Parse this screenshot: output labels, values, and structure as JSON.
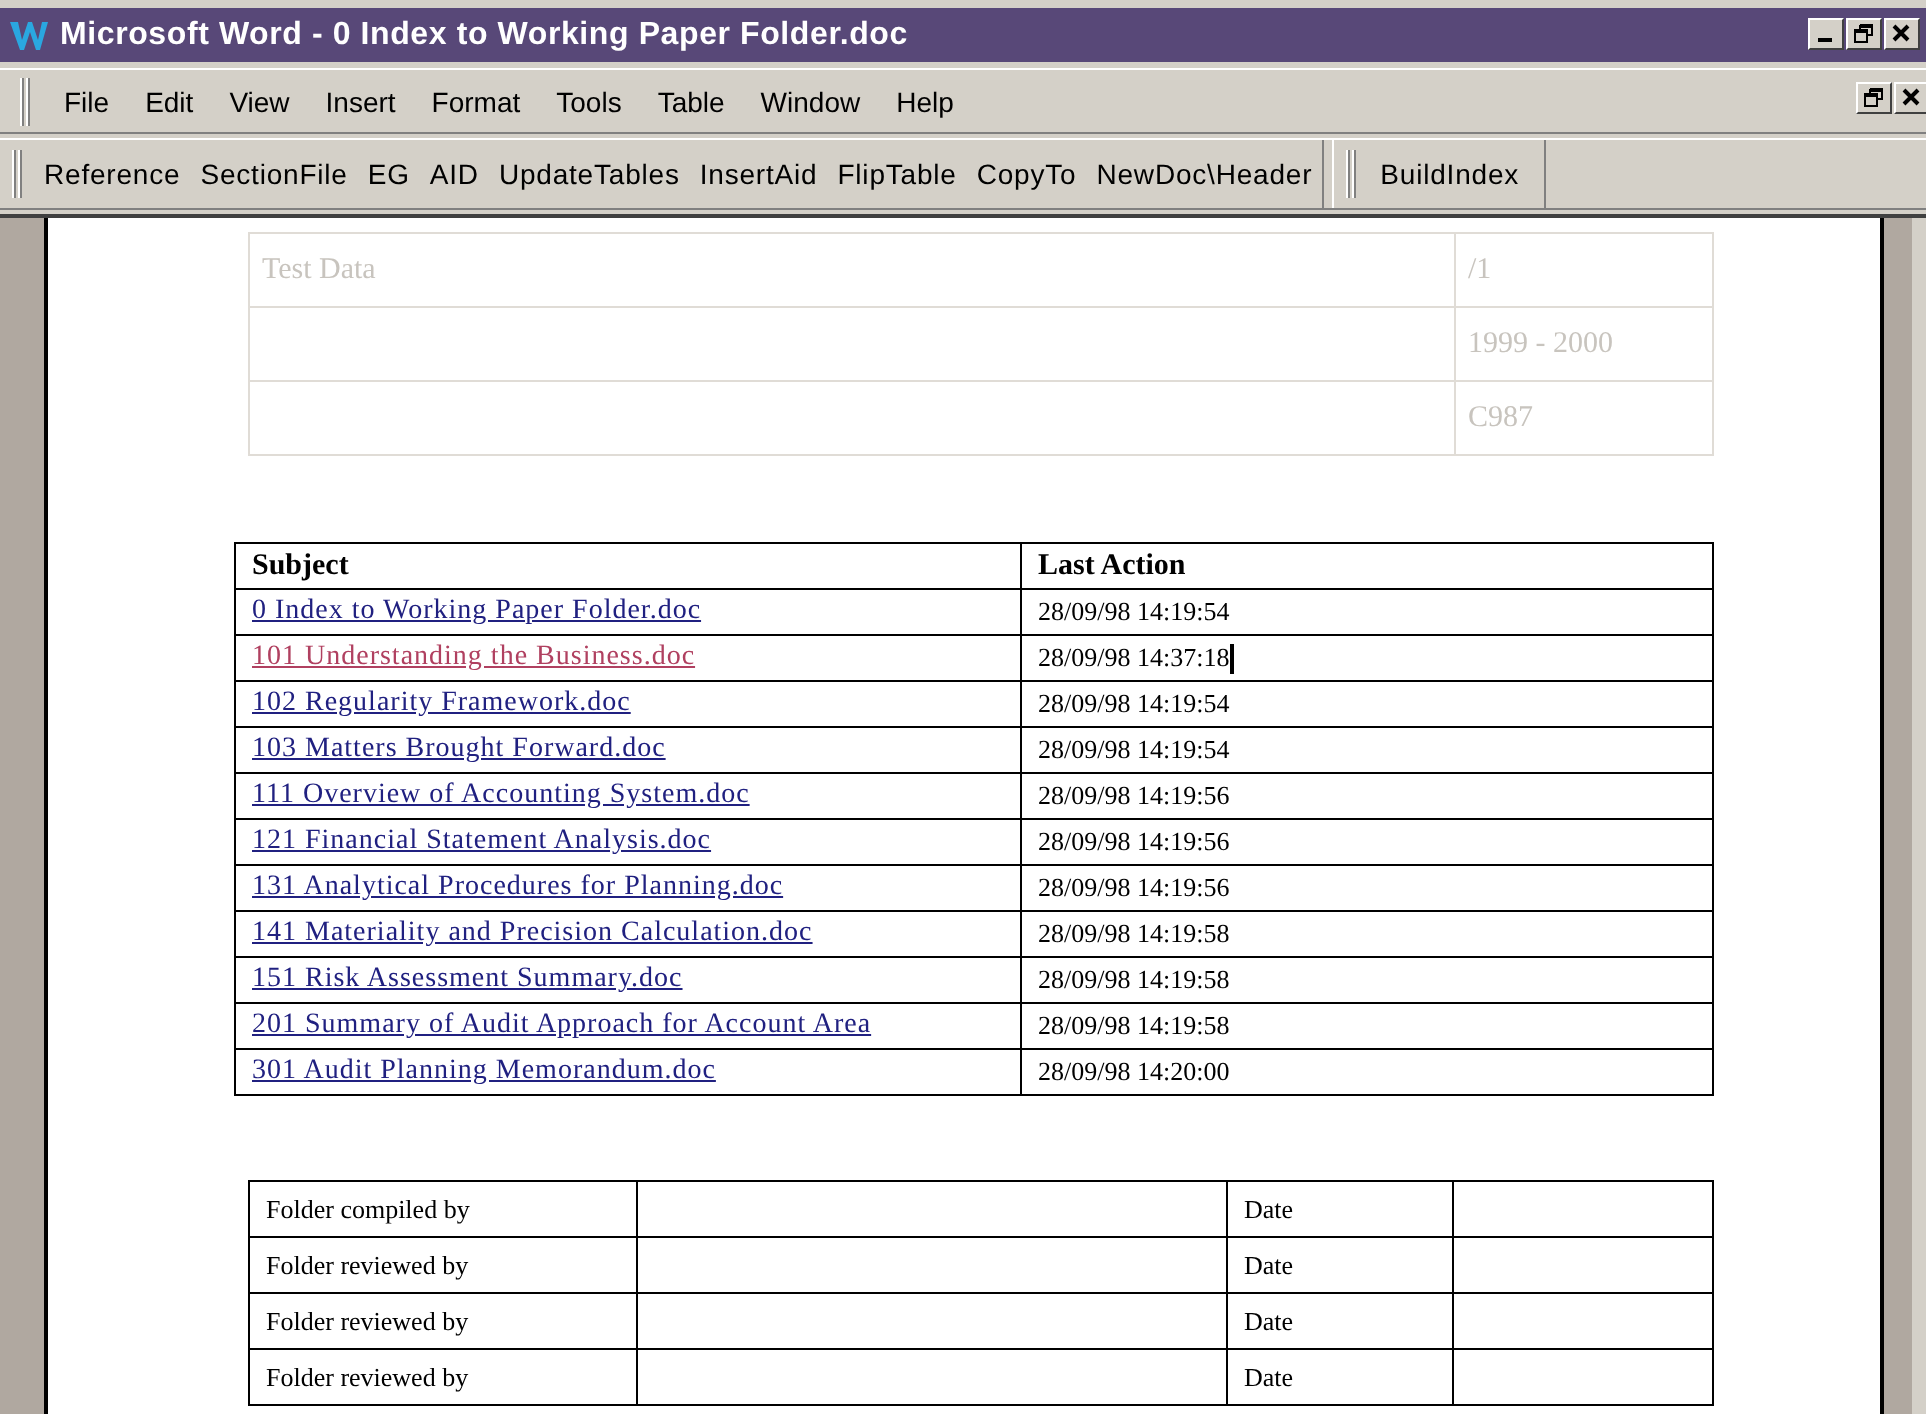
{
  "window": {
    "title": "Microsoft Word - 0 Index to Working Paper Folder.doc"
  },
  "menu_bar": [
    "File",
    "Edit",
    "View",
    "Insert",
    "Format",
    "Tools",
    "Table",
    "Window",
    "Help"
  ],
  "toolbars": [
    {
      "buttons": [
        "Reference",
        "SectionFile",
        "EG",
        "AID",
        "UpdateTables",
        "InsertAid",
        "FlipTable",
        "CopyTo",
        "NewDoc\\Header"
      ]
    },
    {
      "buttons": [
        "BuildIndex"
      ]
    }
  ],
  "document": {
    "header_table": {
      "rows": [
        [
          "Test Data",
          "/1"
        ],
        [
          "",
          "1999 - 2000"
        ],
        [
          "",
          "C987"
        ]
      ]
    },
    "index_table": {
      "columns": [
        "Subject",
        "Last Action"
      ],
      "rows": [
        {
          "subject": "0 Index to Working Paper Folder.doc",
          "last_action": "28/09/98 14:19:54",
          "visited": false
        },
        {
          "subject": "101 Understanding the Business.doc",
          "last_action": "28/09/98 14:37:18",
          "visited": true
        },
        {
          "subject": "102 Regularity Framework.doc",
          "last_action": "28/09/98 14:19:54",
          "visited": false
        },
        {
          "subject": "103 Matters Brought Forward.doc",
          "last_action": "28/09/98 14:19:54",
          "visited": false
        },
        {
          "subject": "111 Overview of Accounting System.doc",
          "last_action": "28/09/98 14:19:56",
          "visited": false
        },
        {
          "subject": "121 Financial Statement Analysis.doc",
          "last_action": "28/09/98 14:19:56",
          "visited": false
        },
        {
          "subject": "131 Analytical Procedures for Planning.doc",
          "last_action": "28/09/98 14:19:56",
          "visited": false
        },
        {
          "subject": "141 Materiality and Precision Calculation.doc",
          "last_action": "28/09/98 14:19:58",
          "visited": false
        },
        {
          "subject": "151 Risk Assessment Summary.doc",
          "last_action": "28/09/98 14:19:58",
          "visited": false
        },
        {
          "subject": "201 Summary of Audit Approach for Account Area",
          "last_action": "28/09/98 14:19:58",
          "visited": false
        },
        {
          "subject": "301 Audit Planning Memorandum.doc",
          "last_action": "28/09/98 14:20:00",
          "visited": false
        }
      ]
    },
    "signoff_table": {
      "rows": [
        {
          "label": "Folder compiled by",
          "date_label": "Date"
        },
        {
          "label": "Folder reviewed by",
          "date_label": "Date"
        },
        {
          "label": "Folder reviewed by",
          "date_label": "Date"
        },
        {
          "label": "Folder reviewed by",
          "date_label": "Date"
        }
      ]
    }
  }
}
